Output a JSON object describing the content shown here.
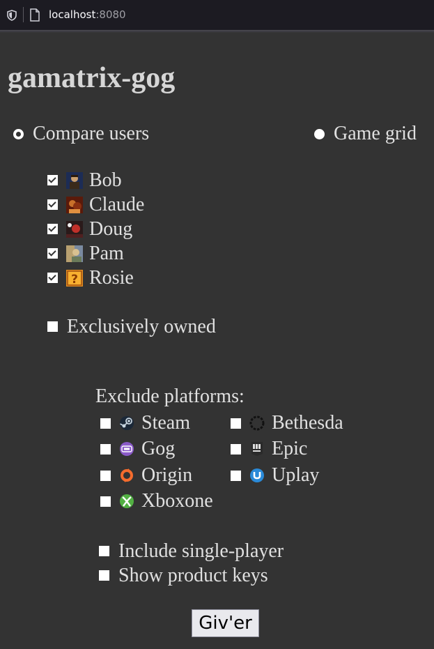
{
  "browser": {
    "url_host": "localhost",
    "url_port": ":8080"
  },
  "app": {
    "title": "gamatrix-gog"
  },
  "modes": {
    "compare_users": "Compare users",
    "game_grid": "Game grid",
    "selected": "compare_users"
  },
  "users": [
    {
      "name": "Bob",
      "checked": true
    },
    {
      "name": "Claude",
      "checked": true
    },
    {
      "name": "Doug",
      "checked": true
    },
    {
      "name": "Pam",
      "checked": true
    },
    {
      "name": "Rosie",
      "checked": true
    }
  ],
  "options": {
    "exclusively_owned": "Exclusively owned",
    "include_single_player": "Include single-player",
    "show_product_keys": "Show product keys"
  },
  "platforms": {
    "heading": "Exclude platforms:",
    "items": [
      {
        "name": "Steam",
        "icon": "steam-icon"
      },
      {
        "name": "Bethesda",
        "icon": "bethesda-icon"
      },
      {
        "name": "Gog",
        "icon": "gog-icon"
      },
      {
        "name": "Epic",
        "icon": "epic-icon"
      },
      {
        "name": "Origin",
        "icon": "origin-icon"
      },
      {
        "name": "Uplay",
        "icon": "uplay-icon"
      },
      {
        "name": "Xboxone",
        "icon": "xbox-icon"
      }
    ]
  },
  "submit": {
    "label": "Giv'er"
  }
}
